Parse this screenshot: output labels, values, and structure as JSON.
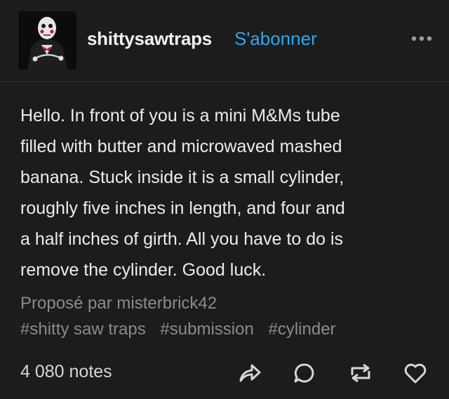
{
  "header": {
    "blog_name": "shittysawtraps",
    "follow_label": "S'abonner",
    "avatar_icon": "jigsaw-puppet-avatar",
    "more_icon": "more-options-icon"
  },
  "post": {
    "body_lines": [
      "Hello. In front of you is a mini M&Ms tube",
      "filled with butter and microwaved mashed",
      "banana. Stuck inside it is a small cylinder,",
      "roughly five inches in length, and four and",
      "a half inches of girth. All you have to do is",
      "remove the cylinder. Good luck."
    ],
    "credit": "Proposé par misterbrick42",
    "tags": [
      "#shitty saw traps",
      "#submission",
      "#cylinder"
    ]
  },
  "footer": {
    "notes": "4 080 notes",
    "actions": [
      "share-icon",
      "reply-icon",
      "reblog-icon",
      "like-icon"
    ]
  },
  "colors": {
    "background": "#1c1c1c",
    "accent": "#2ba7ef",
    "text": "#ececec",
    "muted": "#8b8b8b"
  }
}
